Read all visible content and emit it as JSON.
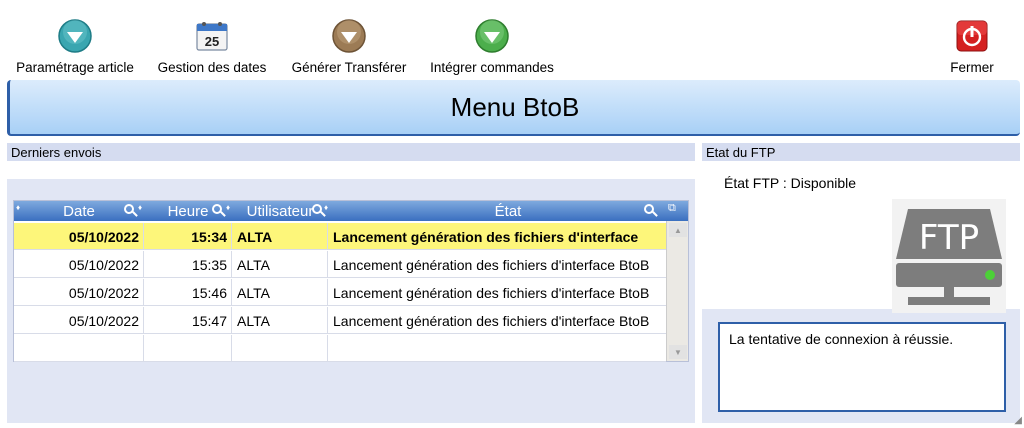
{
  "toolbar": {
    "items": [
      {
        "label": "Paramétrage article",
        "icon": "teal-circle-chevron-icon",
        "color": "#3aa6b0"
      },
      {
        "label": "Gestion des dates",
        "icon": "calendar-icon",
        "day": "25"
      },
      {
        "label": "Générer Transférer",
        "icon": "brown-circle-chevron-icon",
        "color": "#9c7b55"
      },
      {
        "label": "Intégrer commandes",
        "icon": "green-circle-chevron-icon",
        "color": "#4cae4c"
      }
    ],
    "close_label": "Fermer",
    "close_icon": "power-icon",
    "close_color": "#d42020"
  },
  "banner": {
    "title": "Menu BtoB"
  },
  "left_panel": {
    "title": "Derniers envois",
    "columns": [
      "Date",
      "Heure",
      "Utilisateur",
      "État"
    ],
    "rows": [
      {
        "date": "05/10/2022",
        "heure": "15:34",
        "user": "ALTA",
        "etat": "Lancement génération des fichiers d'interface",
        "selected": true
      },
      {
        "date": "05/10/2022",
        "heure": "15:35",
        "user": "ALTA",
        "etat": "Lancement génération des fichiers d'interface BtoB",
        "selected": false
      },
      {
        "date": "05/10/2022",
        "heure": "15:46",
        "user": "ALTA",
        "etat": "Lancement génération des fichiers d'interface BtoB",
        "selected": false
      },
      {
        "date": "05/10/2022",
        "heure": "15:47",
        "user": "ALTA",
        "etat": "Lancement génération des fichiers d'interface BtoB",
        "selected": false
      }
    ]
  },
  "right_panel": {
    "title": "Etat du FTP",
    "status": "État FTP : Disponible",
    "icon_text": "FTP",
    "message": "La tentative de connexion à réussie."
  },
  "colors": {
    "accent": "#2e5fa8",
    "selected_row": "#fdf67a",
    "ftp_led": "#4cd137"
  }
}
